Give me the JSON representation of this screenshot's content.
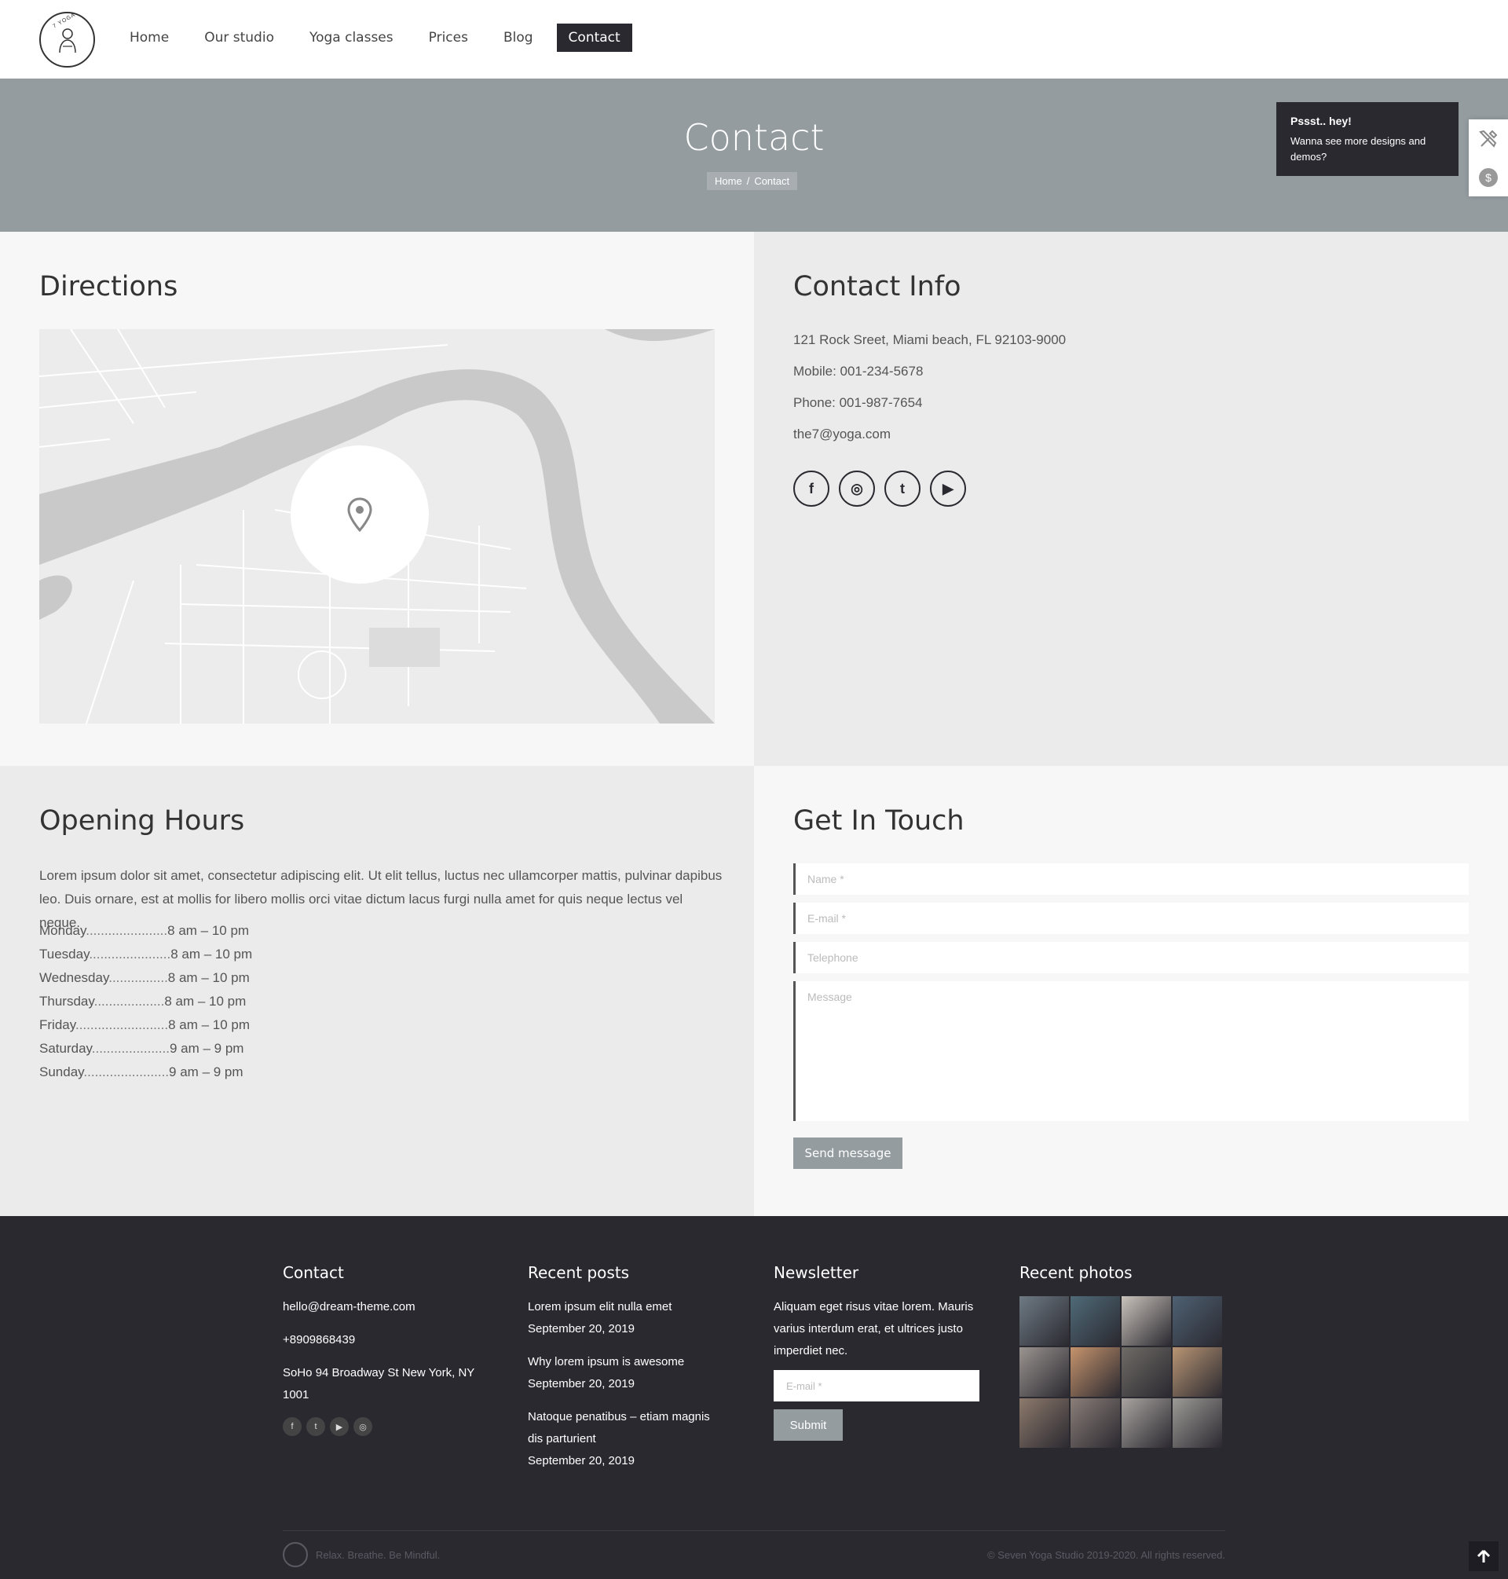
{
  "header": {
    "logo_text": "7 YOGA",
    "nav": [
      "Home",
      "Our studio",
      "Yoga classes",
      "Prices",
      "Blog",
      "Contact"
    ],
    "active": "Contact"
  },
  "banner": {
    "title": "Contact",
    "breadcrumb": [
      "Home",
      "/",
      "Contact"
    ]
  },
  "tooltip": {
    "title": "Pssst.. hey!",
    "text": "Wanna see more designs and demos?"
  },
  "directions": {
    "title": "Directions"
  },
  "contact_info": {
    "title": "Contact Info",
    "address": "121 Rock Sreet,  Miami beach, FL  92103-9000",
    "mobile": "Mobile: 001-234-5678",
    "phone": "Phone: 001-987-7654",
    "email": "the7@yoga.com",
    "social": [
      "f",
      "◎",
      "t",
      "▶"
    ]
  },
  "opening_hours": {
    "title": "Opening Hours",
    "intro": "Lorem ipsum dolor sit amet, consectetur adipiscing elit. Ut elit tellus, luctus nec ullamcorper mattis, pulvinar dapibus leo. Duis ornare, est at mollis for libero mollis orci vitae dictum lacus furgi nulla amet for quis neque lectus vel neque.",
    "days": [
      {
        "day": "Monday",
        "dots": "......................",
        "time": "8 am – 10 pm"
      },
      {
        "day": "Tuesday",
        "dots": "......................",
        "time": "8 am – 10 pm"
      },
      {
        "day": "Wednesday",
        "dots": "................",
        "time": "8 am – 10 pm"
      },
      {
        "day": "Thursday",
        "dots": "...................",
        "time": "8 am – 10 pm"
      },
      {
        "day": "Friday",
        "dots": ".........................",
        "time": "8 am – 10 pm"
      },
      {
        "day": "Saturday",
        "dots": ".....................",
        "time": "9 am – 9 pm"
      },
      {
        "day": "Sunday",
        "dots": ".......................",
        "time": "9 am – 9 pm"
      }
    ]
  },
  "get_in_touch": {
    "title": "Get In Touch",
    "name_placeholder": "Name *",
    "email_placeholder": "E-mail *",
    "telephone_placeholder": "Telephone",
    "message_placeholder": "Message",
    "button": "Send message"
  },
  "footer": {
    "contact": {
      "title": "Contact",
      "email": "hello@dream-theme.com",
      "phone": "+8909868439",
      "address": "SoHo 94 Broadway St New York, NY 1001",
      "social": [
        "f",
        "t",
        "▶",
        "◎"
      ]
    },
    "recent_posts": {
      "title": "Recent posts",
      "posts": [
        {
          "title": "Lorem ipsum elit nulla emet",
          "date": "September 20, 2019"
        },
        {
          "title": "Why lorem ipsum is awesome",
          "date": "September 20, 2019"
        },
        {
          "title": "Natoque penatibus – etiam magnis dis parturient",
          "date": "September 20, 2019"
        }
      ]
    },
    "newsletter": {
      "title": "Newsletter",
      "text": "Aliquam eget risus vitae lorem. Mauris varius interdum erat, et ultrices justo imperdiet nec.",
      "placeholder": "E-mail *",
      "button": "Submit"
    },
    "recent_photos": {
      "title": "Recent photos",
      "tones": [
        "#6e7a84",
        "#4f6a78",
        "#c9c3bb",
        "#4e6173",
        "#9a9490",
        "#c5946d",
        "#6f6b66",
        "#b89574",
        "#8d7a6c",
        "#8a7e78",
        "#a9a4a0",
        "#9d9b96"
      ]
    },
    "tagline": "Relax. Breathe. Be Mindful.",
    "copyright": "© Seven Yoga Studio 2019-2020. All rights reserved."
  },
  "colors": {
    "dark": "#2b2930",
    "banner": "#949ca0",
    "light_bg": "#f7f7f7",
    "grey_bg": "#ebebeb"
  }
}
